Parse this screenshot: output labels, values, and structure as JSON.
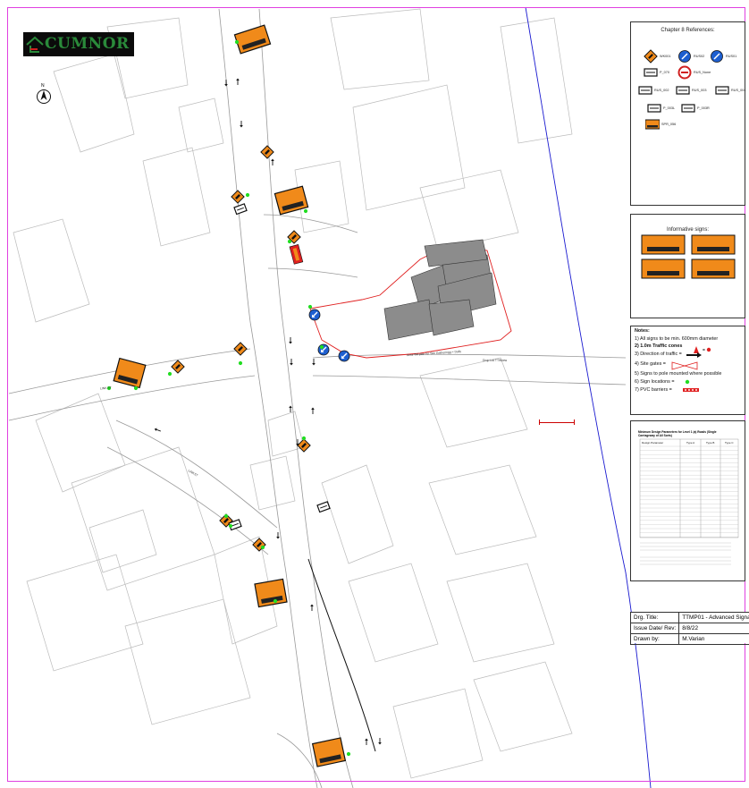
{
  "logo": {
    "text": "CUMNOR"
  },
  "north_label": "N",
  "references": {
    "title": "Chapter 8 References:",
    "items": [
      {
        "label": "WK001",
        "icon": "roadworks-sign-icon"
      },
      {
        "label": "RUS02",
        "icon": "keep-left-sign-icon"
      },
      {
        "label": "RUS01",
        "icon": "keep-right-sign-icon"
      },
      {
        "label": "P_070",
        "icon": "info-plate-icon"
      },
      {
        "label": "RUS_None",
        "icon": "no-entry-sign-icon"
      },
      {
        "label": "RUS_002",
        "icon": "road-narrows-sign-icon"
      },
      {
        "label": "RUS_003",
        "icon": "road-narrows-left-icon"
      },
      {
        "label": "RUS_004",
        "icon": "road-narrows-right-icon"
      },
      {
        "label": "P_003L",
        "icon": "arrow-left-plate-icon"
      },
      {
        "label": "P_003R",
        "icon": "arrow-right-plate-icon"
      },
      {
        "label": "SPR_056",
        "icon": "site-entrance-board-icon"
      }
    ]
  },
  "informative": {
    "title": "Informative signs:"
  },
  "notes": {
    "title": "Notes:",
    "items": [
      "1) All signs to be min. 600mm diameter",
      "2) 1.0m Traffic cones",
      "3) Direction of traffic =",
      "4) Site gates =",
      "5) Signs to pole mounted where possible",
      "6) Sign locations =",
      "7) PVC barriers ="
    ]
  },
  "design_table": {
    "title": "Minimum Design Parameters for Level 1 (a) Roads (Single Carriageway of All Sorts)",
    "headers": [
      "Design Parameter",
      "Type A",
      "Type B",
      "Type C"
    ]
  },
  "title_block": {
    "rows": [
      {
        "label": "Drg. Title:",
        "value": "TTMP01 - Advanced Signage"
      },
      {
        "label": "Issue Date/ Rev:",
        "value": "8/8/22"
      },
      {
        "label": "Drawn by:",
        "value": "M.Varian"
      }
    ]
  },
  "map_labels": {
    "road_a": "LINK ST",
    "road_b": "LINKST",
    "road_c": "Drop Ltd TTW/ww",
    "site_route": "Area TM plan for Site Gatheringg = Daily"
  },
  "colors": {
    "frame": "#e040e0",
    "boundary_line": "#1a1ad0",
    "site_outline": "#e02020",
    "sign_orange": "#f08a1a",
    "sign_blue": "#1e5fd0",
    "location_dot": "#22dd22",
    "building_fill": "#8c8c8c"
  }
}
